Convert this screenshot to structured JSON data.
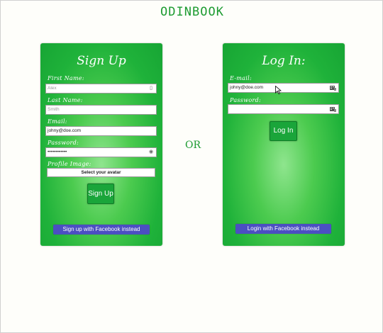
{
  "brand": "ODINBOOK",
  "or_text": "OR",
  "signup": {
    "title": "Sign Up",
    "first_name": {
      "label": "First Name:",
      "placeholder": "Alex"
    },
    "last_name": {
      "label": "Last Name:",
      "placeholder": "Smith"
    },
    "email": {
      "label": "Email:",
      "value": "johny@doe.com"
    },
    "password": {
      "label": "Password:",
      "value": "••••••••••••"
    },
    "profile_image": {
      "label": "Profile Image:",
      "button": "Select your avatar"
    },
    "submit": "Sign Up",
    "facebook": "Sign up with Facebook instead"
  },
  "login": {
    "title": "Log In:",
    "email": {
      "label": "E-mail:",
      "value": "johny@doe.com"
    },
    "password": {
      "label": "Password:",
      "value": ""
    },
    "submit": "Log In",
    "facebook": "Login with Facebook instead"
  },
  "colors": {
    "brand_green": "#1d9b31",
    "card_green": "#1fb23a",
    "facebook_blue": "#4b4fc2"
  }
}
